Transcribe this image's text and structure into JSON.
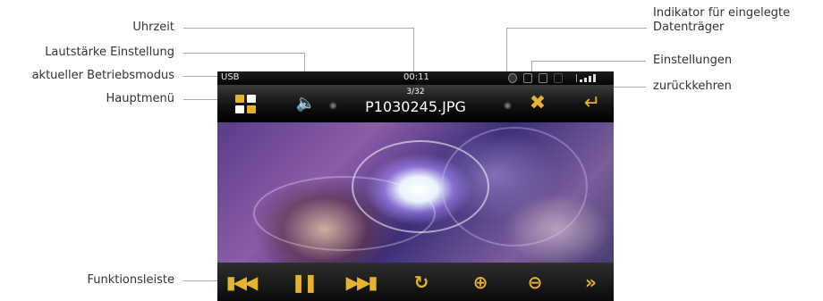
{
  "callouts": {
    "uhrzeit": "Uhrzeit",
    "lautstaerke": "Lautstärke Einstellung",
    "betriebsmodus": "aktueller Betriebsmodus",
    "hauptmenue": "Hauptmenü",
    "funktionsleiste": "Funktionsleiste",
    "indikator_line1": "Indikator für eingelegte",
    "indikator_line2": "Datenträger",
    "einstellungen": "Einstellungen",
    "zurueckkehren": "zurückkehren"
  },
  "device": {
    "status_bar": {
      "mode": "USB",
      "time": "00:11"
    },
    "title_bar": {
      "index": "3/32",
      "filename": "P1030245.JPG"
    },
    "function_bar": {
      "buttons": [
        "previous-icon",
        "pause-icon",
        "next-icon",
        "rotate-icon",
        "zoom-in-icon",
        "zoom-out-icon",
        "fast-forward-icon"
      ]
    },
    "icons": {
      "main_menu": "main-menu-grid-icon",
      "volume": "speaker-volume-icon",
      "settings": "wrench-screwdriver-icon",
      "back": "return-arrow-icon",
      "media": [
        "disc-icon",
        "sd-card-icon",
        "usb-icon"
      ]
    }
  },
  "colors": {
    "accent": "#e6b32e",
    "screen_bg": "#0c0c0c",
    "label_text": "#333333",
    "leader_line": "#aaaaaa"
  }
}
